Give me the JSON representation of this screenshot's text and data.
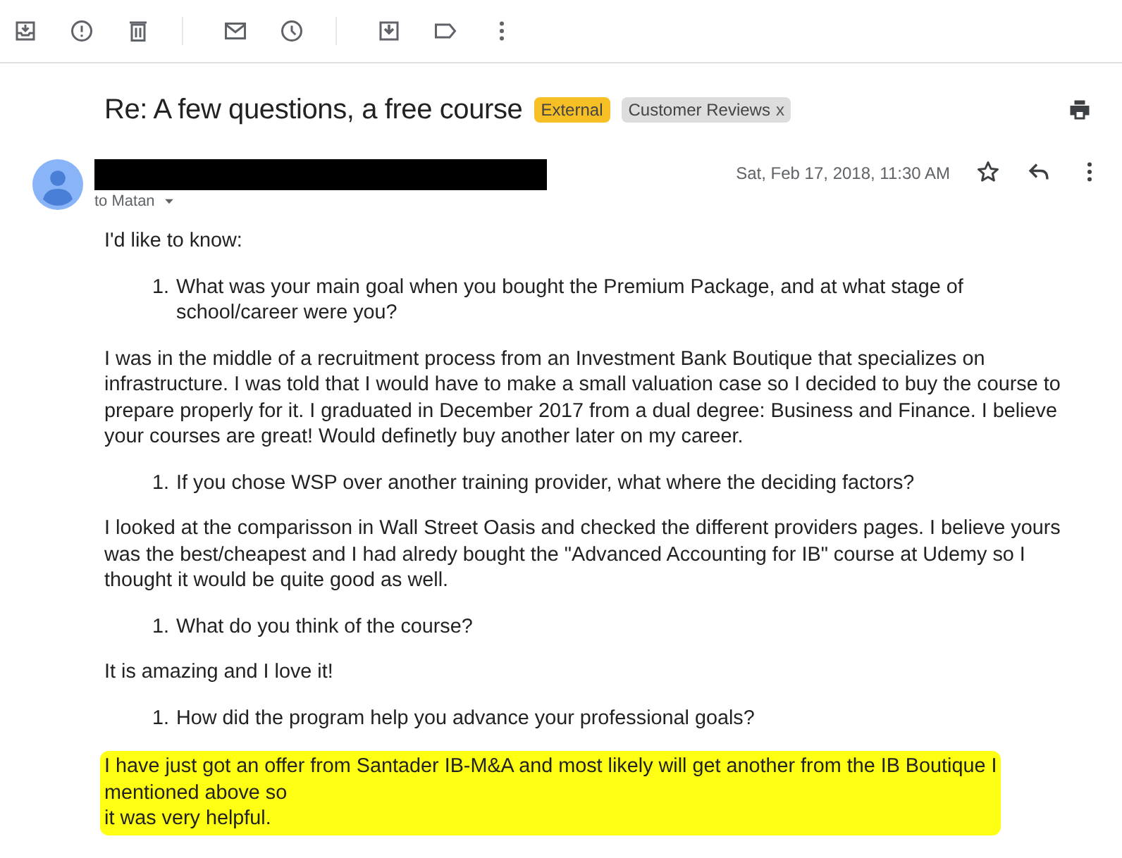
{
  "toolbar": {
    "buttons": [
      {
        "kind": "archive"
      },
      {
        "kind": "spam"
      },
      {
        "kind": "delete"
      },
      {
        "kind": "divider"
      },
      {
        "kind": "mail"
      },
      {
        "kind": "snooze"
      },
      {
        "kind": "divider"
      },
      {
        "kind": "move"
      },
      {
        "kind": "label"
      },
      {
        "kind": "more"
      }
    ]
  },
  "subject": "Re: A few questions, a free course",
  "labels": [
    {
      "text": "External",
      "color": "#f6bf26",
      "removable": false
    },
    {
      "text": "Customer Reviews",
      "color": "#dddddd",
      "removable": true,
      "remove": "x"
    }
  ],
  "sender": {
    "redacted": true,
    "to": "to Matan",
    "date": "Sat, Feb 17, 2018, 11:30 AM"
  },
  "body": [
    {
      "kind": "text",
      "text": "I'd like to know:",
      "highlighted": false
    },
    {
      "kind": "question",
      "number": "1.",
      "text": "What was your main goal when you bought the Premium Package, and at what stage of school/career were you?"
    },
    {
      "kind": "text",
      "text": "I was in the middle of a recruitment process from an Investment Bank Boutique that specializes on infrastructure. I was told that I would have to make a small valuation case so I decided to buy the course to prepare properly for it. I graduated in December 2017 from a dual degree: Business and Finance. I believe your courses are great! Would definetly buy another later on my career.",
      "highlighted": false
    },
    {
      "kind": "question",
      "number": "1.",
      "text": "If you chose WSP over another training provider, what where the deciding factors?"
    },
    {
      "kind": "text",
      "text": "I looked at the comparisson in Wall Street Oasis and checked the different providers pages. I believe yours was the best/cheapest and I had alredy bought the \"Advanced Accounting for IB\" course at Udemy so I thought it would be quite good as well.",
      "highlighted": false
    },
    {
      "kind": "question",
      "number": "1.",
      "text": "What do you think of the course?"
    },
    {
      "kind": "text",
      "text": "It is amazing and I love it!",
      "highlighted": false
    },
    {
      "kind": "question",
      "number": "1.",
      "text": "How did the program help you advance your professional goals?"
    },
    {
      "kind": "text",
      "text": "I have just got an offer from Santader IB-M&A and most likely will get another from the IB Boutique I\nmentioned above so\nit was very helpful.",
      "highlighted": true
    }
  ]
}
